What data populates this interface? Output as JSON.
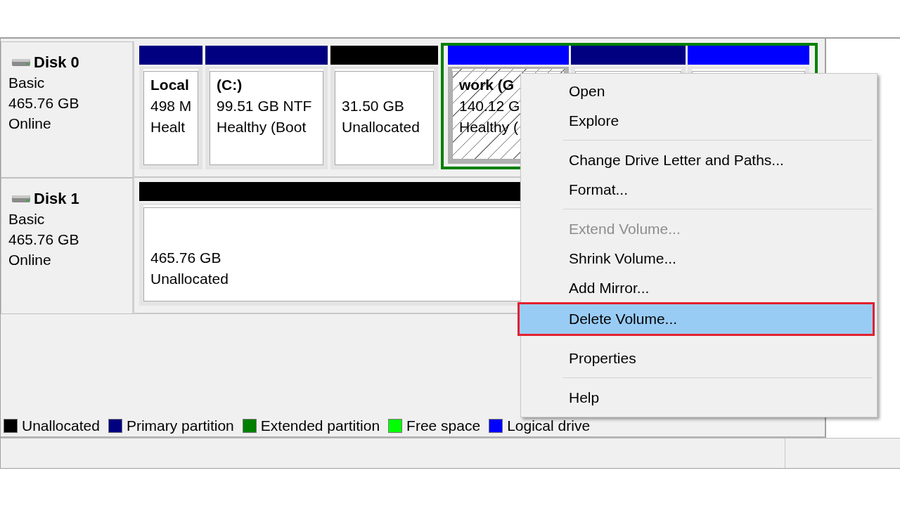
{
  "disks": [
    {
      "name": "Disk 0",
      "type": "Basic",
      "size": "465.76 GB",
      "status": "Online",
      "partitions": [
        {
          "kind": "primary",
          "selected": false,
          "title": "Local",
          "size": "498 M",
          "status": "Healt"
        },
        {
          "kind": "primary",
          "selected": false,
          "title": "(C:)",
          "size": "99.51 GB NTF",
          "status": "Healthy (Boot"
        },
        {
          "kind": "unallocated",
          "selected": false,
          "size": "31.50 GB",
          "status": "Unallocated"
        },
        {
          "kind": "extended",
          "selected": false,
          "children": [
            {
              "kind": "logical",
              "selected": true,
              "title": "work  (G",
              "size": "140.12 G",
              "status": "Healthy ("
            },
            {
              "kind": "primary",
              "selected": false
            },
            {
              "kind": "logical",
              "selected": false
            }
          ]
        }
      ]
    },
    {
      "name": "Disk 1",
      "type": "Basic",
      "size": "465.76 GB",
      "status": "Online",
      "partitions": [
        {
          "kind": "unallocated",
          "selected": false,
          "size": "465.76 GB",
          "status": "Unallocated"
        }
      ]
    }
  ],
  "legend": [
    {
      "label": "Unallocated",
      "color": "#000000"
    },
    {
      "label": "Primary partition",
      "color": "#000080"
    },
    {
      "label": "Extended partition",
      "color": "#008000"
    },
    {
      "label": "Free space",
      "color": "#00ff00"
    },
    {
      "label": "Logical drive",
      "color": "#0000ff"
    }
  ],
  "context_menu": [
    {
      "kind": "item",
      "label": "Open",
      "disabled": false,
      "selected": false,
      "outlined": false
    },
    {
      "kind": "item",
      "label": "Explore",
      "disabled": false,
      "selected": false,
      "outlined": false
    },
    {
      "kind": "separator"
    },
    {
      "kind": "item",
      "label": "Change Drive Letter and Paths...",
      "disabled": false,
      "selected": false,
      "outlined": false
    },
    {
      "kind": "item",
      "label": "Format...",
      "disabled": false,
      "selected": false,
      "outlined": false
    },
    {
      "kind": "separator"
    },
    {
      "kind": "item",
      "label": "Extend Volume...",
      "disabled": true,
      "selected": false,
      "outlined": false
    },
    {
      "kind": "item",
      "label": "Shrink Volume...",
      "disabled": false,
      "selected": false,
      "outlined": false
    },
    {
      "kind": "item",
      "label": "Add Mirror...",
      "disabled": false,
      "selected": false,
      "outlined": false
    },
    {
      "kind": "item",
      "label": "Delete Volume...",
      "disabled": false,
      "selected": true,
      "outlined": true
    },
    {
      "kind": "item",
      "label": "Properties",
      "disabled": false,
      "selected": false,
      "outlined": false
    },
    {
      "kind": "separator"
    },
    {
      "kind": "item",
      "label": "Help",
      "disabled": false,
      "selected": false,
      "outlined": false
    }
  ]
}
